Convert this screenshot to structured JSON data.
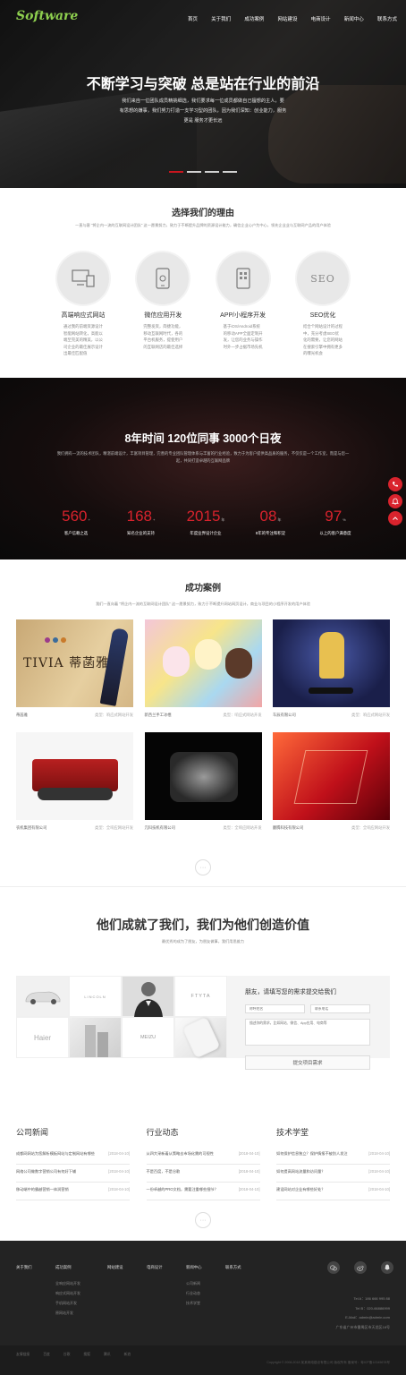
{
  "brand": {
    "logo": "Software",
    "accent": "#d9232d"
  },
  "nav": [
    "首页",
    "关于我们",
    "成功案例",
    "网站建设",
    "电商设计",
    "新闻中心",
    "联系方式"
  ],
  "hero": {
    "title": "不断学习与突破 总是站在行业的前沿",
    "lines": [
      "我们来自一位团队成员精挑细选，我们要求每一位成员都做自己擅想的主人，要",
      "有思想的嫌事，我们努力打造一支学习型的团队，因为我们深知：创业能力，服务",
      "更是 服务才更长远"
    ]
  },
  "why": {
    "title": "选择我们的理由",
    "subtitle": "一直与客 \"将企内一流的互联网设计团队\" 这一愿景努力，致力于不断提升品牌的资源设计能力，确信企业心户为中心，领先企业业与互联网产品的用户体验",
    "items": [
      {
        "icon": "devices-icon",
        "title": "高端响应式网站",
        "desc": "通过我的前端资源设计智能网站转化，高能以端至完美的精美，以公司企业的最佳展示设计出最佳匹配值"
      },
      {
        "icon": "mobile-app-icon",
        "title": "微信应用开发",
        "desc": "完整发资，简捷功能，移动互联网时代，各的平台机服务，提使用户的互联网店的最佳选择"
      },
      {
        "icon": "phone-app-icon",
        "title": "APP/小程序开发",
        "desc": "基于iOS/Android系统的移动APP全面定制开发，让您的业务与操作时外一步占据市场先机"
      },
      {
        "icon": "seo-icon",
        "title": "SEO优化",
        "desc": "结合个网站设计的过程中，充分考虑SEO优化的需要，让您的网站在搜索引擎中拥有更多的曝光机会"
      }
    ]
  },
  "stats": {
    "title": "8年时间  120位同事  3000个日夜",
    "desc": "我们拥有一流的技术团队，精湛前端设计，丰富项目管理，完善的专业团队管理体系与丰富的行业经验，致力于为客户提供高品质的服务，不仅仅是一个工作室，而是与您一起，共同打造卓越的互联网品牌",
    "items": [
      {
        "value": "560",
        "unit": "+",
        "label": "客户信赖之选"
      },
      {
        "value": "168",
        "unit": "+",
        "label": "知名企业的支持"
      },
      {
        "value": "2015",
        "unit": "年",
        "label": "年度业界设计企业"
      },
      {
        "value": "08",
        "unit": "年",
        "label": "8年的专注和积淀"
      },
      {
        "value": "97",
        "unit": "%",
        "label": "以上的客户满意度"
      }
    ]
  },
  "cases": {
    "title": "成功案例",
    "subtitle": "我们一直向着 \"将企内一流的互联网设计团队\" 这一愿景努力，致力于不断提升网站网页设计，商业与项目的小程序开发的用户体验",
    "items": [
      {
        "name": "蒂菡雅",
        "type": "类型：响应式网站开发",
        "img_text": "TIVIA 蒂菡雅"
      },
      {
        "name": "新西兰手工冰棍",
        "type": "类型：响应式网站开发",
        "img_text": ""
      },
      {
        "name": "车辰有限公司",
        "type": "类型：响应式网站开发",
        "img_text": ""
      },
      {
        "name": "农机集团有限公司",
        "type": "类型：全响应网站开发",
        "img_text": ""
      },
      {
        "name": "元科技机有限公司",
        "type": "类型：全响应网站开发",
        "img_text": ""
      },
      {
        "name": "翻腾科技有限公司",
        "type": "类型：全响应网站开发",
        "img_text": ""
      }
    ],
    "more": "···"
  },
  "clients": {
    "title": "他们成就了我们，我们为他们创造价值",
    "subtitle": "最优秀的成为了朋友，为朋友做事，我们用思维力",
    "logos": [
      "",
      "LINCOLN",
      "",
      "FTYTA",
      "Haier",
      "",
      "MEIZU",
      ""
    ]
  },
  "form": {
    "title": "朋友，请填写您的需求提交给我们",
    "name_ph": "称呼姓名",
    "phone_ph": "联系电话",
    "message_ph": "描述你的需求，比如网站、微信、App应用、电商等",
    "submit": "提交项目需求"
  },
  "news": [
    {
      "title": "公司新闻",
      "items": [
        {
          "t": "成都网网站为您解析模板网站与定制网站有哪些",
          "d": "[2018-04-10]"
        },
        {
          "t": "网络公司做数字营销公司有何好下辅",
          "d": "[2018-04-10]"
        },
        {
          "t": "移动端中的霸越营销一体润营销",
          "d": "[2018-04-10]"
        }
      ]
    },
    {
      "title": "行业动态",
      "items": [
        {
          "t": "从四大采新着从策略去市场化需的可视性",
          "d": "[2018-04-10]"
        },
        {
          "t": "不是百度，不是谷歌",
          "d": "[2018-04-10]"
        },
        {
          "t": "一份卓越的PRO文档，需要注重哪些细节？",
          "d": "[2018-04-10]"
        }
      ]
    },
    {
      "title": "技术学堂",
      "items": [
        {
          "t": "如何保护信息独立？保护情报不被别人发注",
          "d": "[2018-04-10]"
        },
        {
          "t": "如何提高网站流量和访问量？",
          "d": "[2018-04-10]"
        },
        {
          "t": "建设网站对企业有哪些好处？",
          "d": "[2018-04-10]"
        }
      ]
    }
  ],
  "footer": {
    "cols": [
      {
        "title": "关于我们",
        "links": []
      },
      {
        "title": "成功案例",
        "links": [
          "全响应网站开发",
          "响应式网站开发",
          "手机网站开发",
          "原网站开发"
        ]
      },
      {
        "title": "网站建设",
        "links": []
      },
      {
        "title": "电商设计",
        "links": []
      },
      {
        "title": "新闻中心",
        "links": [
          "公司新闻",
          "行业动态",
          "技术学堂"
        ]
      },
      {
        "title": "联系方式",
        "links": []
      }
    ],
    "contact": [
      "Tel A：186 666 995 88",
      "Tel B：020-66886999",
      "E-Mail：admin@admin.com",
      "广东省广州市番禺区市天龙区18号"
    ],
    "links": [
      "友情链接",
      "百度",
      "谷歌",
      "搜狐",
      "腾讯",
      "新浪"
    ],
    "copyright": "Copyright © 2008-2018 某某网络建设有限公司 版权所有  备案号：粤ICP备12345678号"
  }
}
